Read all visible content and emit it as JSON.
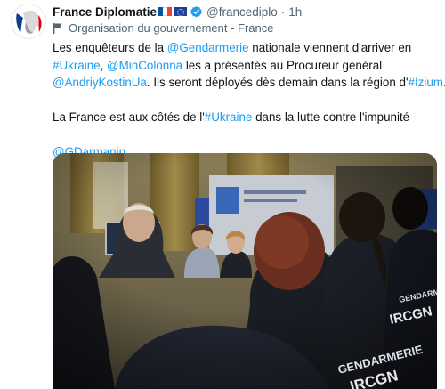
{
  "account": {
    "name": "France Diplomatie",
    "handle": "@francediplo",
    "separator": "·",
    "time": "1h",
    "label": "Organisation du gouvernement - France"
  },
  "tweet": {
    "line1_pre": "Les enquêteurs de la ",
    "line1_link": "@Gendarmerie",
    "line1_post": " nationale viennent d'arriver en",
    "line2_link1": "#Ukraine",
    "line2_mid1": ", ",
    "line2_link2": "@MinColonna",
    "line2_post": " les a présentés au Procureur général",
    "line3_link1": "@AndriyKostinUa",
    "line3_mid": ". Ils seront déployés dès demain dans la région d'",
    "line3_link2": "#Izium",
    "line3_post": ".",
    "line4_pre": "La France est aux côtés de l'",
    "line4_link": "#Ukraine",
    "line4_post": " dans la lutte contre l'impunité",
    "line5_link": "@GDarmanin"
  },
  "photo": {
    "patch_left_1": "GENDARMERIE",
    "patch_left_2": "IRCGN",
    "patch_right_1": "GENDARMERIE",
    "patch_right_2": "IRCGN"
  },
  "colors": {
    "link": "#1d9bf0",
    "verified": "#1d9bf0",
    "secondary_text": "#536471"
  },
  "icons": [
    "avatar-marianne-icon",
    "france-flag-icon",
    "eu-flag-icon",
    "verified-badge-icon",
    "government-label-flag-icon",
    "more-options-icon"
  ]
}
